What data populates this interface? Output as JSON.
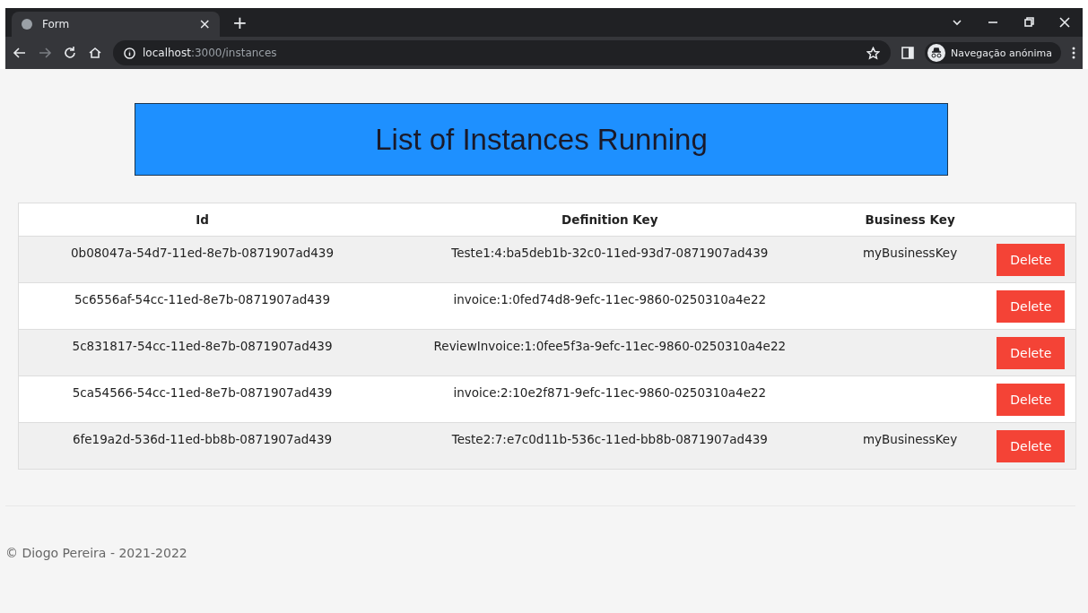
{
  "browser": {
    "tab_title": "Form",
    "tab_close": "×",
    "new_tab": "+",
    "url_host": "localhost",
    "url_path": ":3000/instances",
    "profile": "Navegação anónima"
  },
  "header": {
    "title": "List of Instances Running"
  },
  "table": {
    "columns": [
      "Id",
      "Definition Key",
      "Business Key"
    ],
    "rows": [
      {
        "id": "0b08047a-54d7-11ed-8e7b-0871907ad439",
        "definition_key": "Teste1:4:ba5deb1b-32c0-11ed-93d7-0871907ad439",
        "business_key": "myBusinessKey",
        "action": "Delete"
      },
      {
        "id": "5c6556af-54cc-11ed-8e7b-0871907ad439",
        "definition_key": "invoice:1:0fed74d8-9efc-11ec-9860-0250310a4e22",
        "action": "Delete"
      },
      {
        "id": "5c831817-54cc-11ed-8e7b-0871907ad439",
        "definition_key": "ReviewInvoice:1:0fee5f3a-9efc-11ec-9860-0250310a4e22",
        "action": "Delete"
      },
      {
        "id": "5ca54566-54cc-11ed-8e7b-0871907ad439",
        "definition_key": "invoice:2:10e2f871-9efc-11ec-9860-0250310a4e22",
        "action": "Delete"
      },
      {
        "id": "6fe19a2d-536d-11ed-bb8b-0871907ad439",
        "definition_key": "Teste2:7:e7c0d11b-536c-11ed-bb8b-0871907ad439",
        "business_key": "myBusinessKey",
        "action": "Delete"
      }
    ]
  },
  "footer": {
    "text": "© Diogo Pereira - 2021-2022"
  }
}
